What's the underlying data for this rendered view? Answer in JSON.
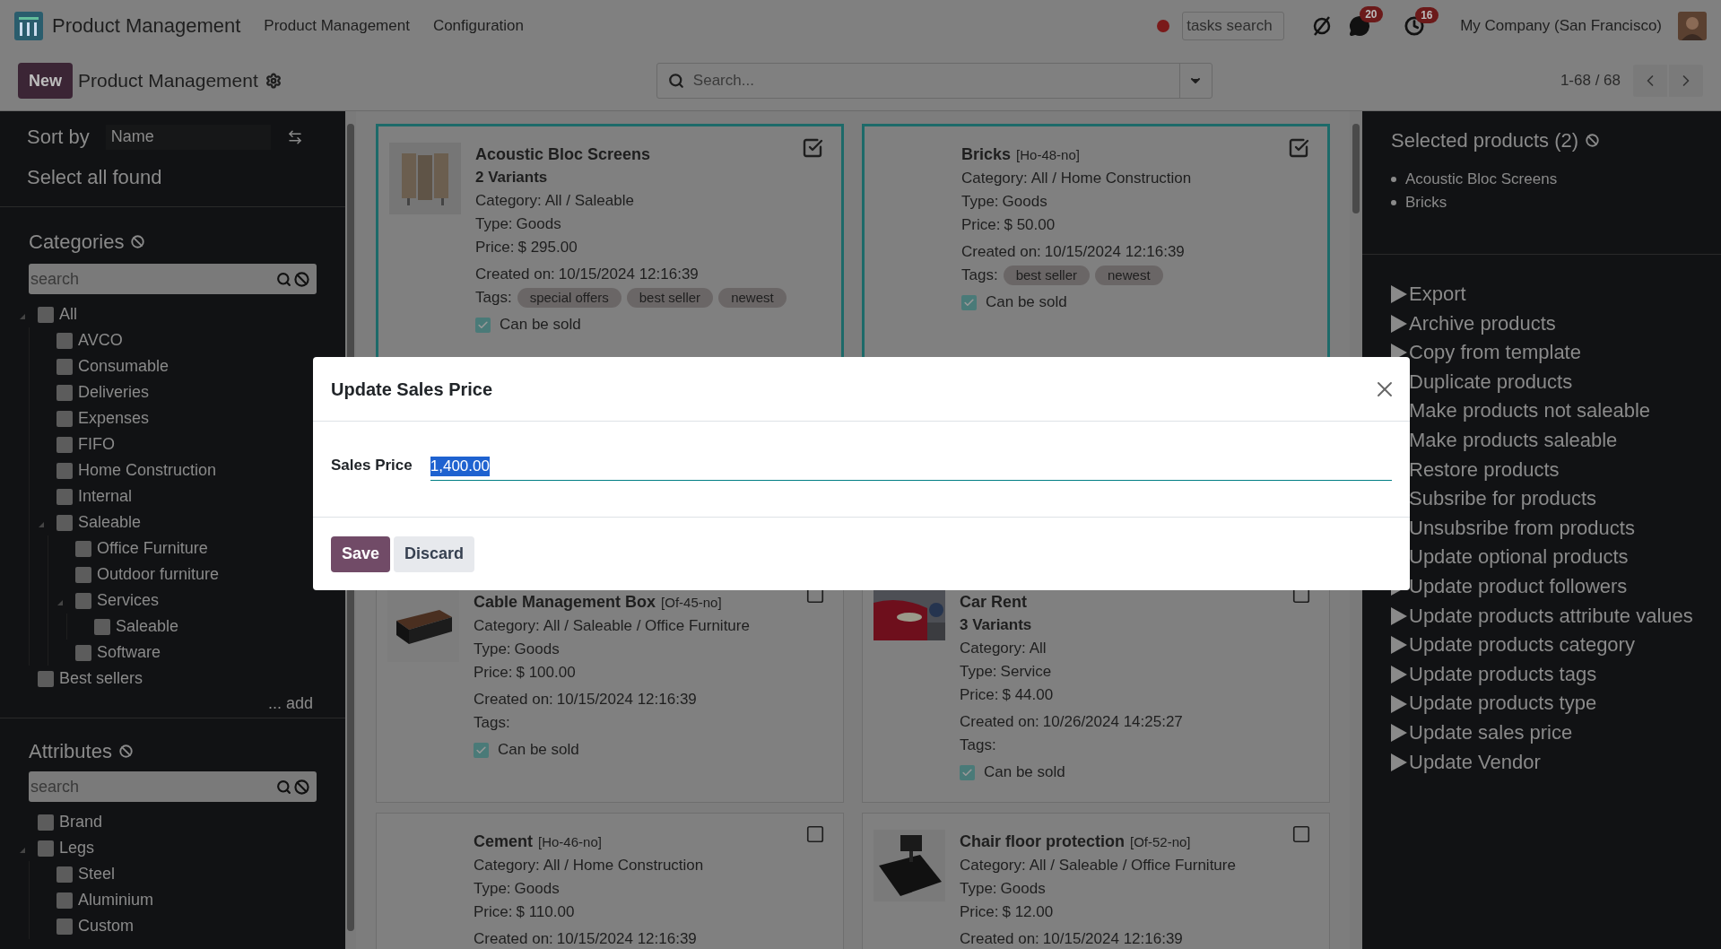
{
  "top_bar": {
    "app_name": "Product Management",
    "menu": [
      "Product Management",
      "Configuration"
    ],
    "tasks_search": {
      "placeholder": "tasks search"
    },
    "messages_badge": "20",
    "activities_badge": "16",
    "company": "My Company (San Francisco)"
  },
  "control_bar": {
    "new_button": "New",
    "breadcrumb": "Product Management",
    "search": {
      "placeholder": "Search..."
    },
    "pager": "1-68 / 68"
  },
  "left_panel": {
    "sort_label": "Sort by",
    "sort_value": "Name",
    "select_all": "Select all found",
    "categories": {
      "title": "Categories",
      "search": {
        "placeholder": "search"
      },
      "add": "... add",
      "tree": [
        {
          "label": "All",
          "checked": false,
          "children": [
            {
              "label": "AVCO",
              "checked": false
            },
            {
              "label": "Consumable",
              "checked": false
            },
            {
              "label": "Deliveries",
              "checked": false
            },
            {
              "label": "Expenses",
              "checked": false
            },
            {
              "label": "FIFO",
              "checked": false
            },
            {
              "label": "Home Construction",
              "checked": false
            },
            {
              "label": "Internal",
              "checked": false
            },
            {
              "label": "Saleable",
              "checked": false,
              "children": [
                {
                  "label": "Office Furniture",
                  "checked": false
                },
                {
                  "label": "Outdoor furniture",
                  "checked": false
                },
                {
                  "label": "Services",
                  "checked": false,
                  "children": [
                    {
                      "label": "Saleable",
                      "checked": false
                    }
                  ]
                },
                {
                  "label": "Software",
                  "checked": false
                }
              ]
            }
          ]
        },
        {
          "label": "Best sellers",
          "checked": false
        }
      ]
    },
    "attributes": {
      "title": "Attributes",
      "search": {
        "placeholder": "search"
      },
      "tree": [
        {
          "label": "Brand",
          "checked": false
        },
        {
          "label": "Legs",
          "checked": false,
          "children": [
            {
              "label": "Steel",
              "checked": false
            },
            {
              "label": "Aluminium",
              "checked": false
            },
            {
              "label": "Custom",
              "checked": false
            }
          ]
        }
      ]
    }
  },
  "cards": [
    {
      "name": "Acoustic Bloc Screens",
      "variants": "2 Variants",
      "selected": true,
      "image": {
        "kind": "picture"
      },
      "fields": [
        {
          "label": "Category:",
          "value": "All / Saleable"
        },
        {
          "label": "Type:",
          "value": "Goods"
        },
        {
          "label": "Price:",
          "value": "$ 295.00"
        }
      ],
      "created": {
        "label": "Created on:",
        "value": "10/15/2024 12:16:39"
      },
      "tags": {
        "label": "Tags:",
        "items": [
          "special offers",
          "best seller",
          "newest"
        ]
      },
      "can_be_sold": {
        "label": "Can be sold",
        "checked": true
      }
    },
    {
      "name": "Bricks",
      "reference": "[Ho-48-no]",
      "selected": true,
      "fields": [
        {
          "label": "Category:",
          "value": "All / Home Construction"
        },
        {
          "label": "Type:",
          "value": "Goods"
        },
        {
          "label": "Price:",
          "value": "$ 50.00"
        }
      ],
      "created": {
        "label": "Created on:",
        "value": "10/15/2024 12:16:39"
      },
      "tags": {
        "label": "Tags:",
        "items": [
          "best seller",
          "newest"
        ]
      },
      "can_be_sold": {
        "label": "Can be sold",
        "checked": true
      }
    },
    {
      "name": "Cable Management Box",
      "reference": "[Of-45-no]",
      "selected": false,
      "image": {
        "kind": "picture"
      },
      "fields": [
        {
          "label": "Category:",
          "value": "All / Saleable / Office Furniture"
        },
        {
          "label": "Type:",
          "value": "Goods"
        },
        {
          "label": "Price:",
          "value": "$ 100.00"
        }
      ],
      "created": {
        "label": "Created on:",
        "value": "10/15/2024 12:16:39"
      },
      "tags": {
        "label": "Tags:"
      },
      "can_be_sold": {
        "label": "Can be sold",
        "checked": true
      }
    },
    {
      "name": "Car Rent",
      "variants": "3 Variants",
      "selected": false,
      "image": {
        "kind": "picture"
      },
      "fields": [
        {
          "label": "Category:",
          "value": "All"
        },
        {
          "label": "Type:",
          "value": "Service"
        },
        {
          "label": "Price:",
          "value": "$ 44.00"
        }
      ],
      "created": {
        "label": "Created on:",
        "value": "10/26/2024 14:25:27"
      },
      "tags": {
        "label": "Tags:"
      },
      "can_be_sold": {
        "label": "Can be sold",
        "checked": true
      }
    },
    {
      "name": "Cement",
      "reference": "[Ho-46-no]",
      "selected": false,
      "fields": [
        {
          "label": "Category:",
          "value": "All / Home Construction"
        },
        {
          "label": "Type:",
          "value": "Goods"
        },
        {
          "label": "Price:",
          "value": "$ 110.00"
        }
      ],
      "created": {
        "label": "Created on:",
        "value": "10/15/2024 12:16:39"
      }
    },
    {
      "name": "Chair floor protection",
      "reference": "[Of-52-no]",
      "selected": false,
      "image": {
        "kind": "picture"
      },
      "fields": [
        {
          "label": "Category:",
          "value": "All / Saleable / Office Furniture"
        },
        {
          "label": "Type:",
          "value": "Goods"
        },
        {
          "label": "Price:",
          "value": "$ 12.00"
        }
      ],
      "created": {
        "label": "Created on:",
        "value": "10/15/2024 12:16:39"
      }
    }
  ],
  "right_panel": {
    "selected_title": "Selected products (2)",
    "selected_items": [
      "Acoustic Bloc Screens",
      "Bricks"
    ],
    "actions": [
      "Export",
      "Archive products",
      "Copy from template",
      "Duplicate products",
      "Make products not saleable",
      "Make products saleable",
      "Restore products",
      "Subsribe for products",
      "Unsubsribe from products",
      "Update optional products",
      "Update product followers",
      "Update products attribute values",
      "Update products category",
      "Update products tags",
      "Update products type",
      "Update sales price",
      "Update Vendor"
    ]
  },
  "dialog": {
    "title": "Update Sales Price",
    "field_label": "Sales Price",
    "field_value": "1,400.00",
    "buttons": [
      "Save",
      "Discard"
    ]
  }
}
